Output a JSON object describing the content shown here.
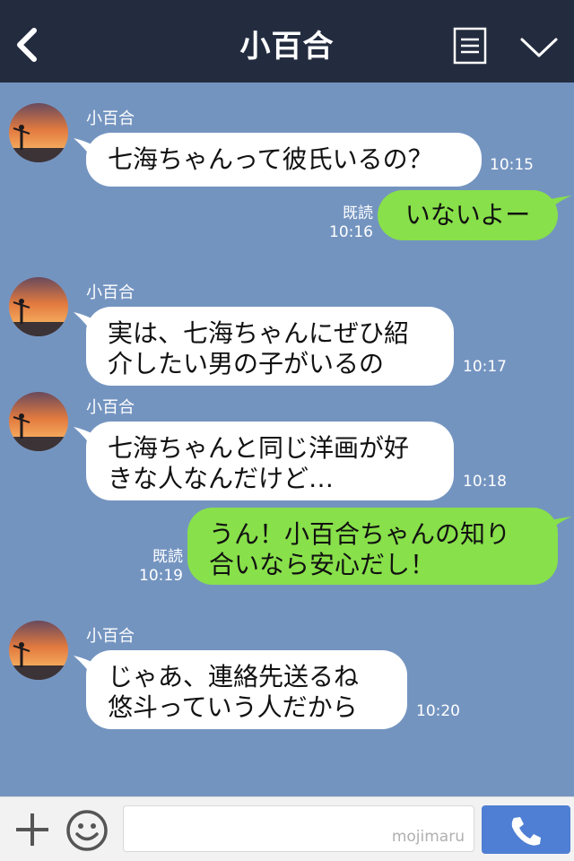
{
  "header": {
    "title": "小百合",
    "back_icon": "chevron-left-icon",
    "menu_icon": "menu-list-icon",
    "collapse_icon": "chevron-down-icon"
  },
  "messages": [
    {
      "sender": "小百合",
      "text": "七海ちゃんって彼氏いるの？",
      "time": "10:15"
    },
    {
      "mine": true,
      "read": "既読",
      "time": "10:16",
      "text": "いないよー"
    },
    {
      "sender": "小百合",
      "text": "実は、七海ちゃんにぜひ紹\n介したい男の子がいるの",
      "time": "10:17"
    },
    {
      "sender": "小百合",
      "text": "七海ちゃんと同じ洋画が好\nきな人なんだけど…",
      "time": "10:18"
    },
    {
      "mine": true,
      "read": "既読",
      "time": "10:19",
      "text": "うん！小百合ちゃんの知り\n合いなら安心だし！"
    },
    {
      "sender": "小百合",
      "text": "じゃあ、連絡先送るね\n悠斗っていう人だから",
      "time": "10:20"
    }
  ],
  "footer": {
    "plus_icon": "plus-icon",
    "emoji_icon": "smiley-icon",
    "input_value": "",
    "watermark": "mojimaru",
    "call_icon": "phone-icon"
  },
  "colors": {
    "header_bg": "#232c3f",
    "chat_bg": "#7494c0",
    "my_bubble": "#88e04a",
    "their_bubble": "#ffffff",
    "call_button": "#4f7fd4"
  }
}
